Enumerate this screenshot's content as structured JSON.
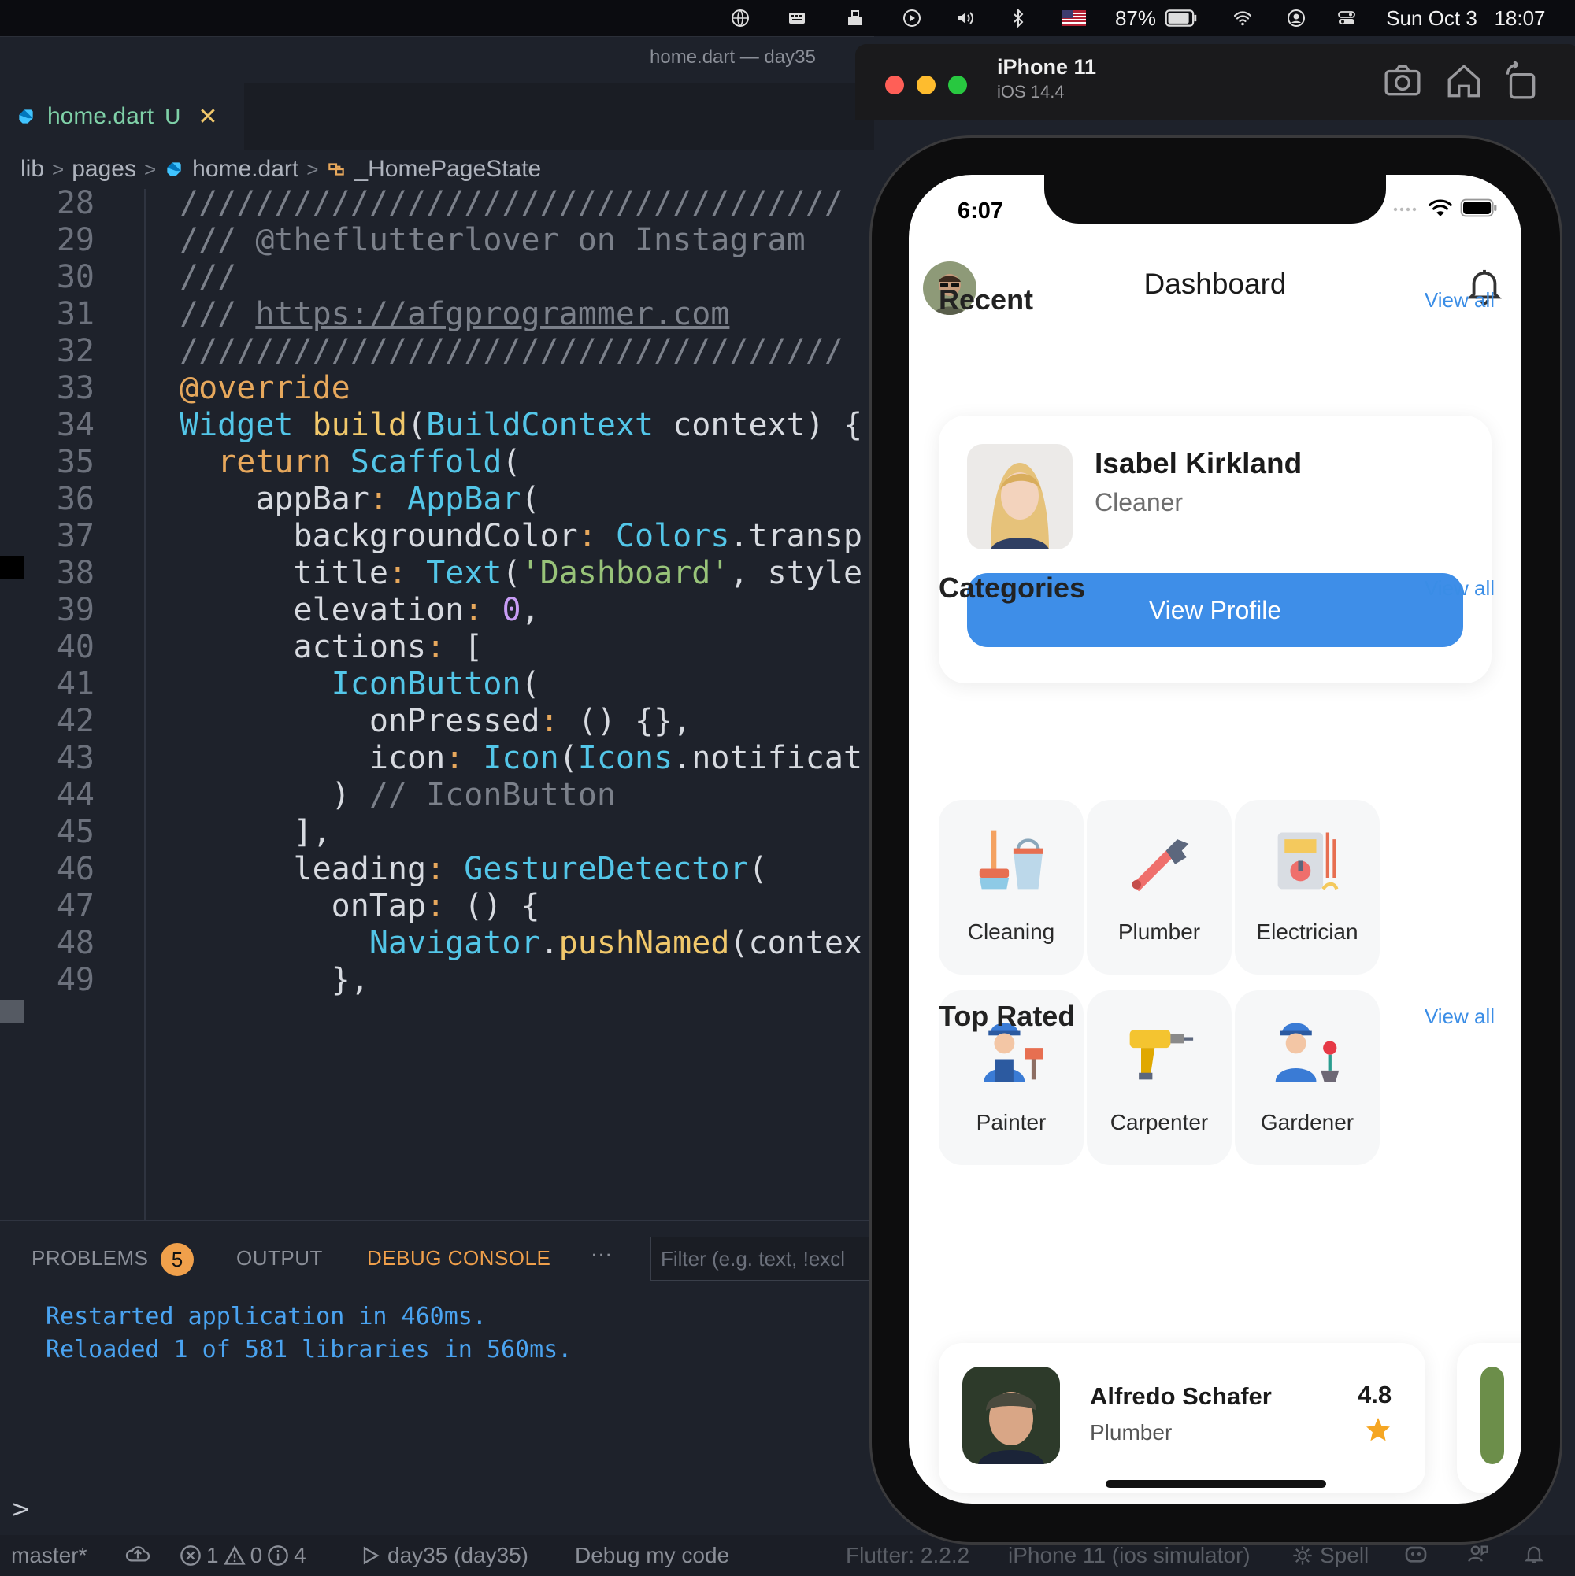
{
  "menubar": {
    "battery": "87%",
    "date": "Sun Oct 3",
    "time": "18:07"
  },
  "vscode": {
    "window_title": "home.dart — day35",
    "tab": {
      "name": "home.dart",
      "modified": "U",
      "close": "✕"
    },
    "breadcrumb": [
      "lib",
      "pages",
      "home.dart",
      "_HomePageState"
    ],
    "code_lines": [
      {
        "n": "28",
        "text": "///////////////////////////////////"
      },
      {
        "n": "29",
        "text": "/// @theflutterlover on Instagram"
      },
      {
        "n": "30",
        "text": "///"
      },
      {
        "n": "31",
        "text": "/// https://afgprogrammer.com"
      },
      {
        "n": "32",
        "text": "///////////////////////////////////"
      },
      {
        "n": "33",
        "text": "@override"
      },
      {
        "n": "34",
        "text": "Widget build(BuildContext context) {"
      },
      {
        "n": "35",
        "text": "  return Scaffold("
      },
      {
        "n": "36",
        "text": "    appBar: AppBar("
      },
      {
        "n": "37",
        "text": "      backgroundColor: Colors.transp"
      },
      {
        "n": "38",
        "text": "      title: Text('Dashboard', style"
      },
      {
        "n": "39",
        "text": "      elevation: 0,"
      },
      {
        "n": "40",
        "text": "      actions: ["
      },
      {
        "n": "41",
        "text": "        IconButton("
      },
      {
        "n": "42",
        "text": "          onPressed: () {},"
      },
      {
        "n": "43",
        "text": "          icon: Icon(Icons.notificat"
      },
      {
        "n": "44",
        "text": "        ) // IconButton"
      },
      {
        "n": "45",
        "text": "      ],"
      },
      {
        "n": "46",
        "text": "      leading: GestureDetector("
      },
      {
        "n": "47",
        "text": "        onTap: () {"
      },
      {
        "n": "48",
        "text": "          Navigator.pushNamed(contex"
      },
      {
        "n": "49",
        "text": "        },"
      }
    ],
    "panel": {
      "tabs": [
        "PROBLEMS",
        "OUTPUT",
        "DEBUG CONSOLE",
        "···"
      ],
      "problems_count": "5",
      "filter_placeholder": "Filter (e.g. text, !excl",
      "console": [
        "Restarted application in 460ms.",
        "Reloaded 1 of 581 libraries in 560ms."
      ]
    },
    "statusbar": {
      "branch": "master*",
      "errors": "1",
      "warnings": "0",
      "infos": "4",
      "debug_target": "day35 (day35)",
      "debug_my_code": "Debug my code",
      "flutter": "Flutter: 2.2.2",
      "device": "iPhone 11 (ios simulator)",
      "spell": "Spell"
    },
    "command_chevron": ">"
  },
  "simulator": {
    "device": "iPhone 11",
    "os": "iOS 14.4"
  },
  "app": {
    "status_time": "6:07",
    "title": "Dashboard",
    "recent": {
      "title": "Recent",
      "view_all": "View all",
      "name": "Isabel Kirkland",
      "role": "Cleaner",
      "button": "View Profile"
    },
    "categories": {
      "title": "Categories",
      "view_all": "View all",
      "items": [
        "Cleaning",
        "Plumber",
        "Electrician",
        "Painter",
        "Carpenter",
        "Gardener"
      ]
    },
    "top_rated": {
      "title": "Top Rated",
      "view_all": "View all",
      "name": "Alfredo Schafer",
      "role": "Plumber",
      "rating": "4.8"
    },
    "colors": {
      "accent": "#3e8ee8",
      "star": "#f5a623"
    }
  }
}
